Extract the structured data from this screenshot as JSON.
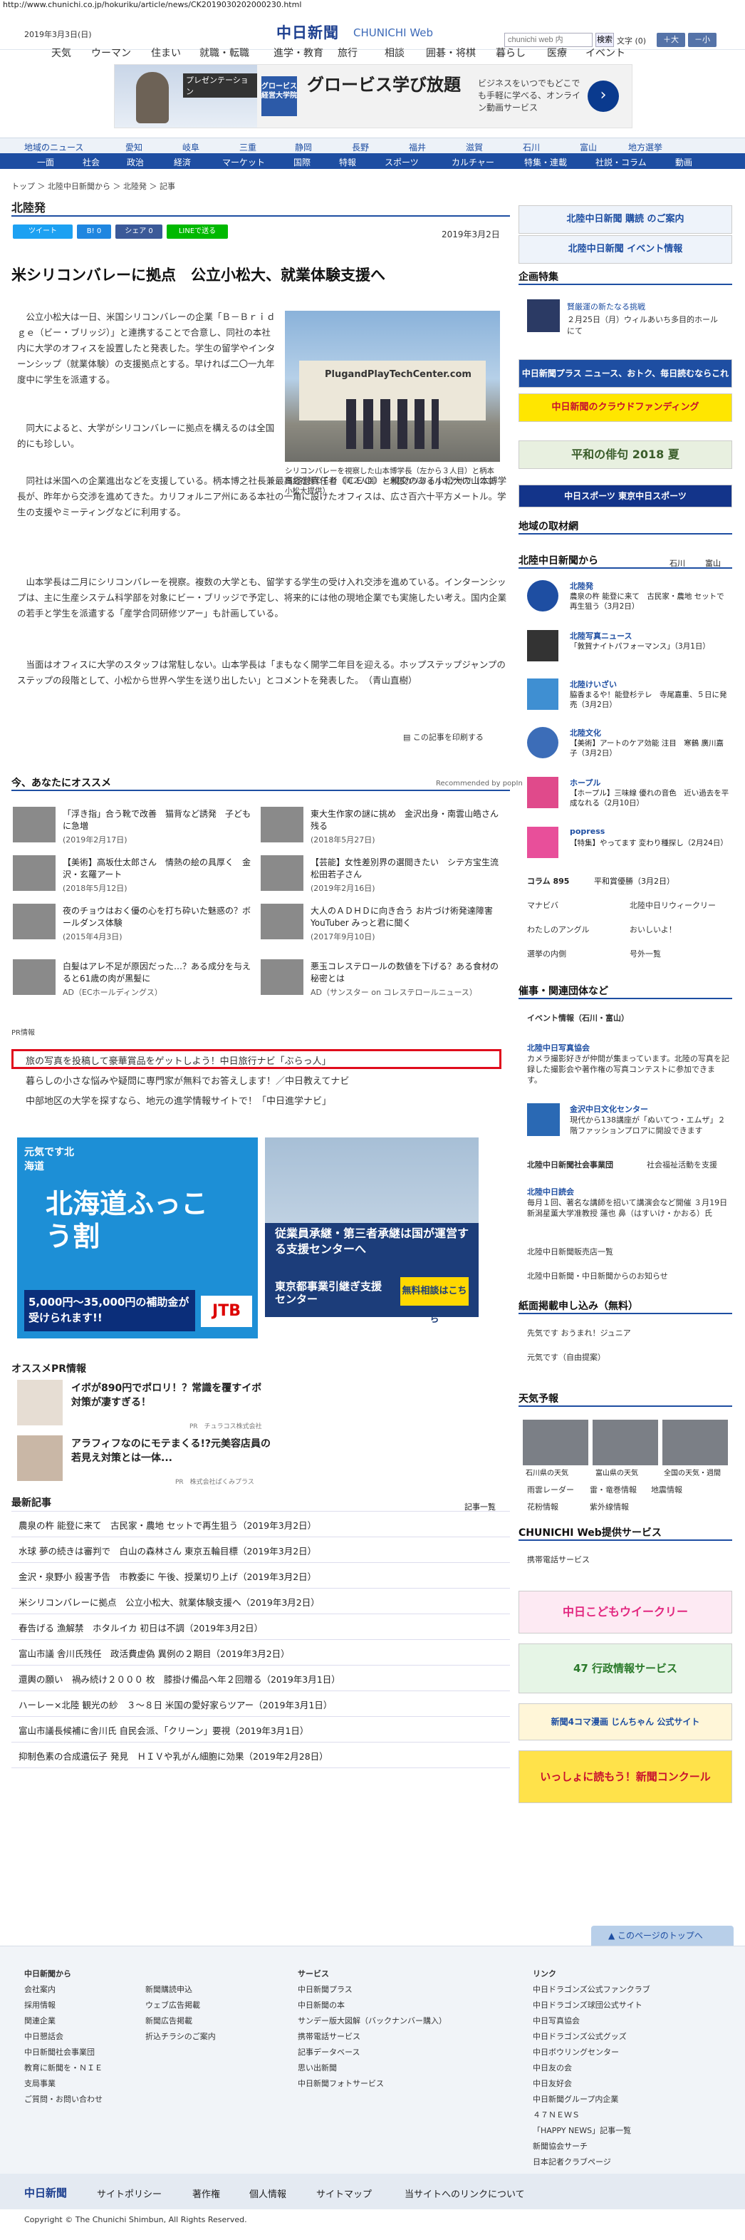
{
  "url": "http://www.chunichi.co.jp/hokuriku/article/news/CK2019030202000230.html",
  "header": {
    "date": "2019年3月3日(日)",
    "logo": "中日新聞",
    "logo_sub": "CHUNICHI Web",
    "search_placeholder": "chunichi web 内",
    "search_button": "検索",
    "font_size_label": "文字",
    "font_size_value": "(0)",
    "font_up": "＋大",
    "font_down": "－小"
  },
  "nav1": [
    "天気",
    "ウーマン",
    "住まい",
    "就職・転職",
    "進学・教育",
    "旅行",
    "相談",
    "囲碁・将棋",
    "暮らし",
    "医療",
    "イベント"
  ],
  "ad_top": {
    "badge": "プレゼンテーション",
    "brand": "グロービス経営大学院",
    "title": "グロービス学び放題",
    "desc": "ビジネスをいつでもどこでも手軽に学べる、オンライン動画サービス",
    "arrow": "›"
  },
  "nav2": [
    "地域のニュース",
    "愛知",
    "岐阜",
    "三重",
    "静岡",
    "長野",
    "福井",
    "滋賀",
    "石川",
    "富山",
    "地方選挙"
  ],
  "nav3": [
    "一面",
    "社会",
    "政治",
    "経済",
    "マーケット",
    "国際",
    "特報",
    "スポーツ",
    "カルチャー",
    "特集・連載",
    "社説・コラム",
    "動画"
  ],
  "breadcrumb": "トップ ＞ 北陸中日新聞から ＞ 北陸発 ＞ 記事",
  "section_title": "北陸発",
  "share": {
    "tweet": "ツイート",
    "b": "B! 0",
    "fb": "シェア 0",
    "line": "LINEで送る"
  },
  "article_date": "2019年3月2日",
  "headline": "米シリコンバレーに拠点　公立小松大、就業体験支援へ",
  "paragraphs": [
    "公立小松大は一日、米国シリコンバレーの企業「Ｂ－Ｂｒｉｄｇｅ（ビー・ブリッジ）」と連携することで合意し、同社の本社内に大学のオフィスを設置したと発表した。学生の留学やインターンシップ（就業体験）の支援拠点とする。早ければ二〇一九年度中に学生を派遣する。",
    "同大によると、大学がシリコンバレーに拠点を構えるのは全国的にも珍しい。",
    "同社は米国への企業進出などを支援している。柄本博之社長兼最高経営責任者（ＣＥＯ）と親交のある小松大の山本博学長が、昨年から交渉を進めてきた。カリフォルニア州にある本社の一角に設けたオフィスは、広さ百六十平方メートル。学生の支援やミーティングなどに利用する。",
    "山本学長は二月にシリコンバレーを視察。複数の大学とも、留学する学生の受け入れ交渉を進めている。インターンシップは、主に生産システム科学部を対象にビー・ブリッジで予定し、将来的には他の現地企業でも実施したい考え。国内企業の若手と学生を派遣する「産学合同研修ツアー」も計画している。",
    "当面はオフィスに大学のスタッフは常駐しない。山本学長は「まもなく開学二年目を迎える。ホップステップジャンプのステップの段階として、小松から世界へ学生を送り出したい」とコメントを発表した。　（青山直樹）"
  ],
  "photo_sign": "PlugandPlayTechCenter.com",
  "caption": "シリコンバレーを視察した山本博学長（左から３人目）と柄本博之社長ＣＥＯ（同２人目）＝米国カリフォルニア州で（公立小松大提供）",
  "print_label": "この記事を印刷する",
  "recommend": {
    "title": "今、あなたにオススメ",
    "powered": "Recommended by popIn",
    "items": [
      {
        "text": "「浮き指」合う靴で改善　猫背など誘発　子どもに急増",
        "date": "(2019年2月17日)"
      },
      {
        "text": "東大生作家の謎に挑め　金沢出身・南雲山皓さん残る",
        "date": "(2018年5月27日)"
      },
      {
        "text": "【美術】高坂仕太郎さん　情熱の絵の具厚く　金沢・玄羅アート",
        "date": "(2018年5月12日)"
      },
      {
        "text": "【芸能】女性差別界の選閲きたい　シテ方宝生流 松田若子さん",
        "date": "(2019年2月16日)"
      },
      {
        "text": "夜のチョウはおく優の心を打ち砕いた魅惑の？ボールダンス体験",
        "date": "(2015年4月3日)"
      },
      {
        "text": "大人のＡＤＨＤに向き合う お片づけ術発達障害YouTuber みっと君に聞く",
        "date": "(2017年9月10日)"
      },
      {
        "text": "白髪はアレ不足が原因だった…？ある成分を与えると61歳の肉が黒髪に",
        "date": "AD（ECホールディングス）"
      },
      {
        "text": "悪玉コレステロールの数値を下げる？ある食材の秘密とは",
        "date": "AD（サンスター on コレステロールニュース）"
      }
    ]
  },
  "pr": {
    "label": "PR情報",
    "lines": [
      "旅の写真を投稿して豪華賞品をゲットしよう！中日旅行ナビ「ぶらっ人」",
      "暮らしの小さな悩みや疑問に専門家が無料でお答えします！／中日教えてナビ",
      "中部地区の大学を探すなら、地元の進学情報サイトで！「中日進学ナビ」"
    ]
  },
  "ad2": {
    "a_title": "北海道ふっこう割",
    "a_sub": "元気です北海道",
    "a_price": "5,000円〜35,000円の補助金が受けられます!!",
    "a_brand": "JTB",
    "b_title": "従業員承継・第三者承継は国が運営する支援センターへ",
    "b_org": "東京都事業引継ぎ支援センター",
    "b_btn": "無料相談はこちら"
  },
  "osusume_pr": {
    "title": "オススメPR情報",
    "items": [
      {
        "text": "イボが890円でポロリ！？常識を覆すイボ対策が凄すぎる！",
        "src": "PR　チュラコス株式会社"
      },
      {
        "text": "アラフィフなのにモテまくる!?元美容店員の若見え対策とは一体...",
        "src": "PR　株式会社ぱくみプラス"
      }
    ]
  },
  "latest": {
    "title": "最新記事",
    "more": "記事一覧",
    "items": [
      "農泉の杵 能登に来て　古民家・農地 セットで再生狙う（2019年3月2日）",
      "水球 夢の続きは審判で　白山の森林さん 東京五輪目標（2019年3月2日）",
      "金沢・泉野小 殺害予告　市教委に 午後、授業切り上げ（2019年3月2日）",
      "米シリコンバレーに拠点　公立小松大、就業体験支援へ（2019年3月2日）",
      "春告げる 漁解禁　ホタルイカ 初日は不調（2019年3月2日）",
      "富山市議 舎川氏残任　政活費虚偽 異例の２期目（2019年3月2日）",
      "還輿の願い　禍み続け２０００ 枚　膝掛け備品へ年２回贈る（2019年3月1日）",
      "ハーレー×北陸 観光の紗　３〜８日 米国の愛好家らツアー（2019年3月1日）",
      "富山市議長候補に舎川氏 自民会派、「クリーン」要視（2019年3月1日）",
      "抑制色素の合成遺伝子 発見　ＨＩＶや乳がん細胞に効果（2019年2月28日）"
    ]
  },
  "sidebar": {
    "subscribe": "北陸中日新聞 購読 のご案内",
    "event": "北陸中日新聞 イベント情報",
    "kikaku": "企画特集",
    "kikaku_item_title": "賢厳運の新たなる挑戦",
    "kikaku_item_desc": "２月25日（月）ウィルあいち多目的ホールにて",
    "banner1": "中日新聞プラス ニュース、おトク、毎日読むならこれ",
    "banner2": "中日新聞のクラウドファンディング",
    "banner3": "平和の俳句 2018 夏",
    "banner4": "中日スポーツ 東京中日スポーツ",
    "local": "地域の取材網",
    "from": "北陸中日新聞から",
    "from_tabs": [
      "石川",
      "富山"
    ],
    "from_items": [
      {
        "title": "北陸発",
        "desc": "農泉の杵 能登に来て　古民家・農地 セットで再生狙う（3月2日）"
      },
      {
        "title": "北陸写真ニュース",
        "desc": "「敦賀ナイトパフォーマンス」（3月1日）"
      },
      {
        "title": "北陸けいざい",
        "desc": "脇香まるや！能登杉テレ　寺尾嘉重、５日に発売（3月2日）"
      },
      {
        "title": "北陸文化",
        "desc": "【美術】アートのケア効能 注目　寒鶴 廣川嘉子（3月2日）"
      },
      {
        "title": "ホープル",
        "desc": "【ホープル】三味線 優れの音色　近い過去を平成なれる（2月10日）"
      },
      {
        "title": "popress",
        "desc": "【特集】やってます 変わり種探し（2月24日）"
      }
    ],
    "column_title": "コラム 895",
    "column_title2": "平和賞優勝（3月2日）",
    "links": [
      "マナビバ",
      "北陸中日リウィークリー",
      "わたしのアングル",
      "おいしいよ！",
      "選挙の内側",
      "号外一覧"
    ],
    "rel_title": "催事・関連団体など",
    "rel_event": "イベント情報（石川・富山）",
    "rel_items": [
      {
        "title": "北陸中日写真協会",
        "desc": "カメラ撮影好きが仲間が集まっています。北陸の写真を記録した撮影会や著作権の写真コンテストに参加できます。"
      },
      {
        "title": "金沢中日文化センター",
        "desc": "現代から138講座が「ぬいてつ・エムザ」２階ファッションプロアに開設できます"
      },
      {
        "title": "北陸中日新聞社会事業団",
        "desc": "社会福祉活動を支援"
      },
      {
        "title": "北陸中日読会",
        "desc": "毎月１回、著名な講師を招いて講演会など開催 ３月19日 新潟星薫大学准教授 蓮也 鼻（はすいけ・かおる）氏"
      },
      {
        "title": "北陸中日新聞販売店一覧",
        "desc": ""
      },
      {
        "title": "北陸中日新聞・中日新聞からのお知らせ",
        "desc": ""
      }
    ],
    "kami_title": "紙面掲載申し込み（無料）",
    "kami": [
      "先気です おうまれ！ジュニア",
      "元気です（自由提案）"
    ],
    "tenki_title": "天気予報",
    "tenki": [
      "石川県の天気",
      "富山県の天気",
      "全国の天気・週間"
    ],
    "tenki_links": [
      "雨雲レーダー",
      "雷・竜巻情報",
      "地震情報",
      "花粉情報",
      "紫外線情報"
    ],
    "service_title": "CHUNICHI Web提供サービス",
    "service": "携帯電話サービス",
    "b5": "中日こどもウイークリー",
    "b6": "47 行政情報サービス",
    "b7": "新聞4コマ漫画 じんちゃん 公式サイト",
    "b8": "いっしょに読もう！新聞コンクール"
  },
  "to_top": "このページのトップへ",
  "footer": {
    "col1": [
      "中日新聞から",
      "会社案内",
      "採用情報",
      "関連企業",
      "中日懇話会",
      "中日新聞社会事業団",
      "教育に新聞を・ＮＩＥ",
      "支局事業",
      "ご質問・お問い合わせ"
    ],
    "col2": [
      "新聞購読申込",
      "ウェブ広告掲載",
      "新聞広告掲載",
      "折込チラシのご案内"
    ],
    "col3": [
      "サービス",
      "中日新聞プラス",
      "中日新聞の本",
      "サンデー版大図解（バックナンバー購入）",
      "携帯電話サービス",
      "記事データベース",
      "思い出新聞",
      "中日新聞フォトサービス"
    ],
    "col4": [
      "リンク",
      "中日ドラゴンズ公式ファンクラブ",
      "中日ドラゴンズ球団公式サイト",
      "中日写真協会",
      "中日ドラゴンズ公式グッズ",
      "中日ボウリングセンター",
      "中日友の会",
      "中日友好会",
      "中日新聞グループ内企業",
      "４７ＮＥＷＳ",
      "「HAPPY NEWS」記事一覧",
      "新聞協会サーチ",
      "日本記者クラブページ"
    ],
    "bar": [
      "中日新聞",
      "サイトポリシー",
      "著作権",
      "個人情報",
      "サイトマップ",
      "当サイトへのリンクについて"
    ],
    "copyright": "Copyright © The Chunichi Shimbun, All Rights Reserved."
  },
  "colors": {
    "brand": "#1e4ea2",
    "pr_border": "#e00c1c"
  }
}
